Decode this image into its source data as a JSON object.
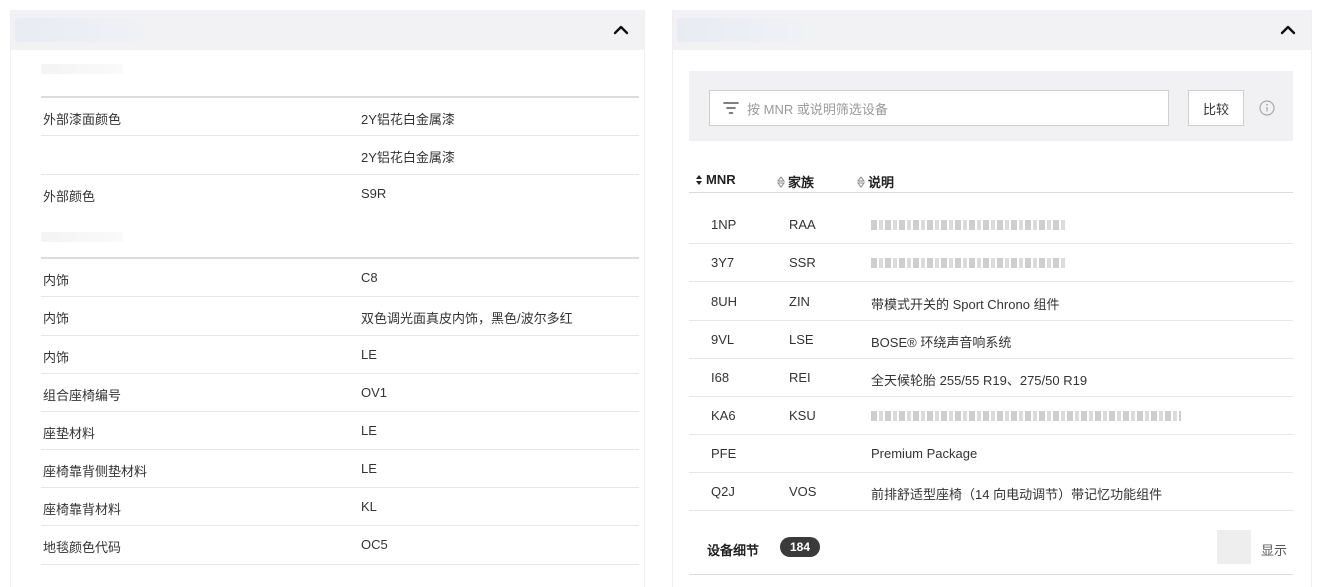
{
  "left_panel": {
    "rows": [
      {
        "label": "外部漆面颜色",
        "value": "2Y铝花白金属漆"
      },
      {
        "label": "",
        "value": "2Y铝花白金属漆"
      },
      {
        "label": "外部颜色",
        "value": "S9R"
      },
      {
        "label": "内饰",
        "value": "C8"
      },
      {
        "label": "内饰",
        "value": "双色调光面真皮内饰，黑色/波尔多红"
      },
      {
        "label": "内饰",
        "value": "LE"
      },
      {
        "label": "组合座椅编号",
        "value": "OV1"
      },
      {
        "label": "座垫材料",
        "value": "LE"
      },
      {
        "label": "座椅靠背侧垫材料",
        "value": "LE"
      },
      {
        "label": "座椅靠背材料",
        "value": "KL"
      },
      {
        "label": "地毯颜色代码",
        "value": "OC5"
      }
    ]
  },
  "right_panel": {
    "filter": {
      "placeholder": "按 MNR 或说明筛选设备",
      "compare_label": "比较"
    },
    "table": {
      "headers": {
        "mnr": "MNR",
        "family": "家族",
        "description": "说明"
      },
      "rows": [
        {
          "mnr": "1NP",
          "family": "RAA",
          "description": "",
          "blurred": true,
          "blur_width": 196
        },
        {
          "mnr": "3Y7",
          "family": "SSR",
          "description": "",
          "blurred": true,
          "blur_width": 196
        },
        {
          "mnr": "8UH",
          "family": "ZIN",
          "description": "带模式开关的 Sport Chrono 组件",
          "blurred": false
        },
        {
          "mnr": "9VL",
          "family": "LSE",
          "description": "BOSE® 环绕声音响系统",
          "blurred": false
        },
        {
          "mnr": "I68",
          "family": "REI",
          "description": "全天候轮胎 255/55 R19、275/50 R19",
          "blurred": false
        },
        {
          "mnr": "KA6",
          "family": "KSU",
          "description": "",
          "blurred": true,
          "blur_width": 310
        },
        {
          "mnr": "PFE",
          "family": "",
          "description": "Premium Package",
          "blurred": false
        },
        {
          "mnr": "Q2J",
          "family": "VOS",
          "description": "前排舒适型座椅（14 向电动调节）带记忆功能组件",
          "blurred": false
        }
      ]
    },
    "footer": {
      "label": "设备细节",
      "count": "184",
      "show_label": "显示"
    }
  }
}
